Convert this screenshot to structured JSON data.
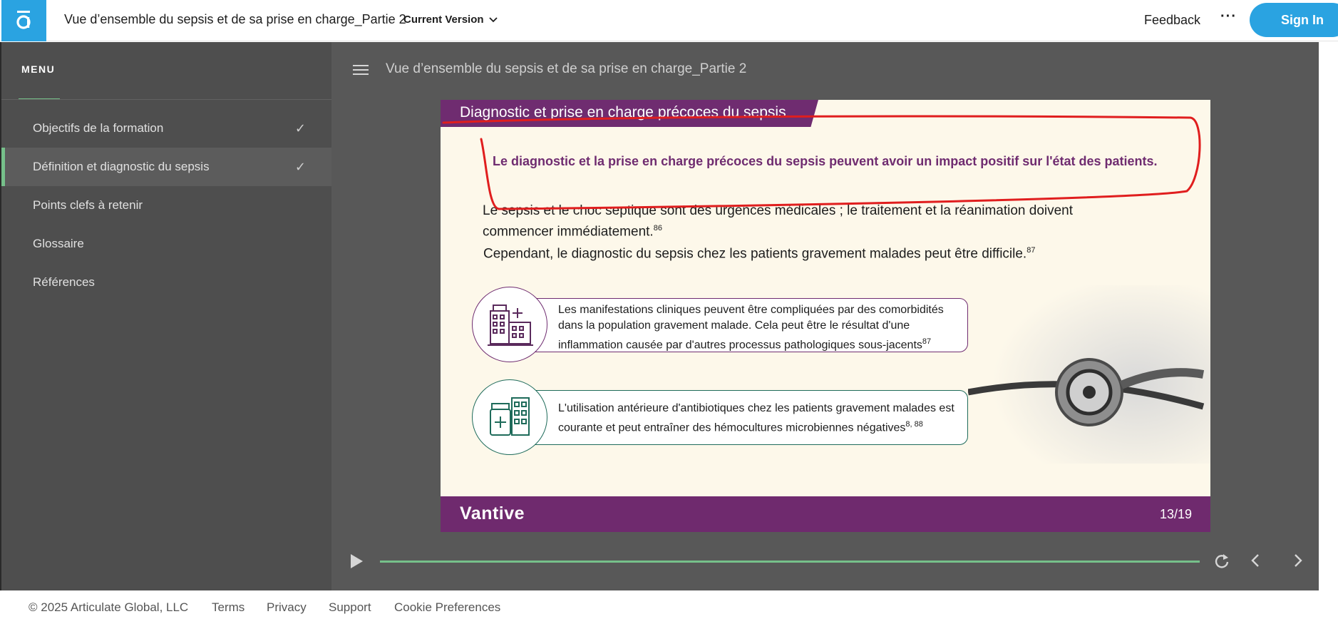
{
  "header": {
    "course_title": "Vue d’ensemble du sepsis et de sa prise en charge_Partie 2",
    "version_label": "Current Version",
    "feedback_label": "Feedback",
    "more_label": "···",
    "signin_label": "Sign In",
    "accent_color": "#2aa3e1"
  },
  "sidebar": {
    "heading": "MENU",
    "items": [
      {
        "label": "Objectifs de la formation",
        "completed": true
      },
      {
        "label": "Définition et diagnostic du sepsis",
        "completed": true,
        "active": true
      },
      {
        "label": "Points clefs à retenir",
        "completed": false
      },
      {
        "label": "Glossaire",
        "completed": false
      },
      {
        "label": "Références",
        "completed": false
      }
    ],
    "check_glyph": "✓"
  },
  "player": {
    "title": "Vue d’ensemble du sepsis et de sa prise en charge_Partie 2"
  },
  "slide": {
    "banner": "Diagnostic et prise en charge précoces du sepsis",
    "lead": "Le diagnostic et la prise en charge précoces du sepsis peuvent avoir un impact positif sur l'état des patients.",
    "p1_text": "Le sepsis et le choc septique sont des urgences médicales ; le traitement et la réanimation doivent commencer immédiatement.",
    "p1_ref": "86",
    "p2_text": "Cependant, le diagnostic du sepsis chez les patients gravement malades peut être difficile.",
    "p2_ref": "87",
    "card1_text": "Les manifestations cliniques peuvent être compliquées par des comorbidités dans la population gravement malade. Cela peut être le résultat d'une inflammation causée par d'autres processus pathologiques sous-jacents",
    "card1_ref": "87",
    "card2_text": "L'utilisation antérieure d'antibiotiques chez les patients gravement malades est courante et peut entraîner des hémocultures microbiennes négatives",
    "card2_ref": "8, 88",
    "brand": "Vantive",
    "page": "13/19",
    "brand_color": "#6f2c70"
  },
  "footer": {
    "copyright": "© 2025 Articulate Global, LLC",
    "links": [
      "Terms",
      "Privacy",
      "Support",
      "Cookie Preferences"
    ]
  }
}
